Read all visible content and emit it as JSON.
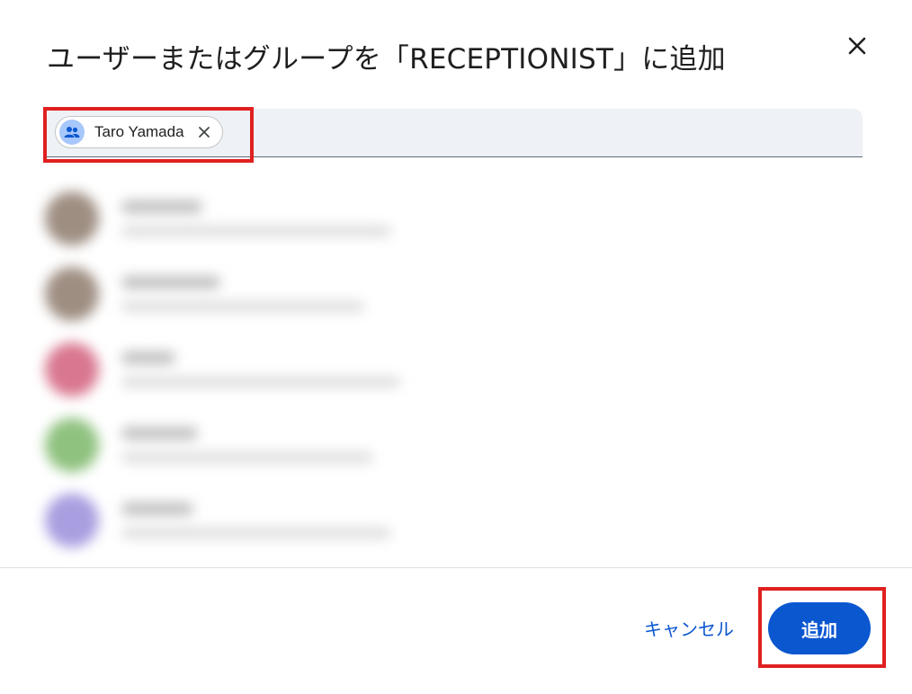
{
  "dialog": {
    "title": "ユーザーまたはグループを「RECEPTIONIST」に追加",
    "close_icon": "close-icon"
  },
  "input": {
    "chips": [
      {
        "label": "Taro Yamada",
        "icon": "group-icon",
        "remove_icon": "close-icon"
      }
    ]
  },
  "results": {
    "note": "",
    "avatar_colors": [
      "#9e8e82",
      "#9e8e82",
      "#d9778f",
      "#8fc27f",
      "#a99ee0"
    ]
  },
  "footer": {
    "cancel_label": "キャンセル",
    "add_label": "追加"
  },
  "colors": {
    "accent": "#0b57d0",
    "highlight": "#e02020",
    "chip_avatar": "#a8c7fa"
  }
}
